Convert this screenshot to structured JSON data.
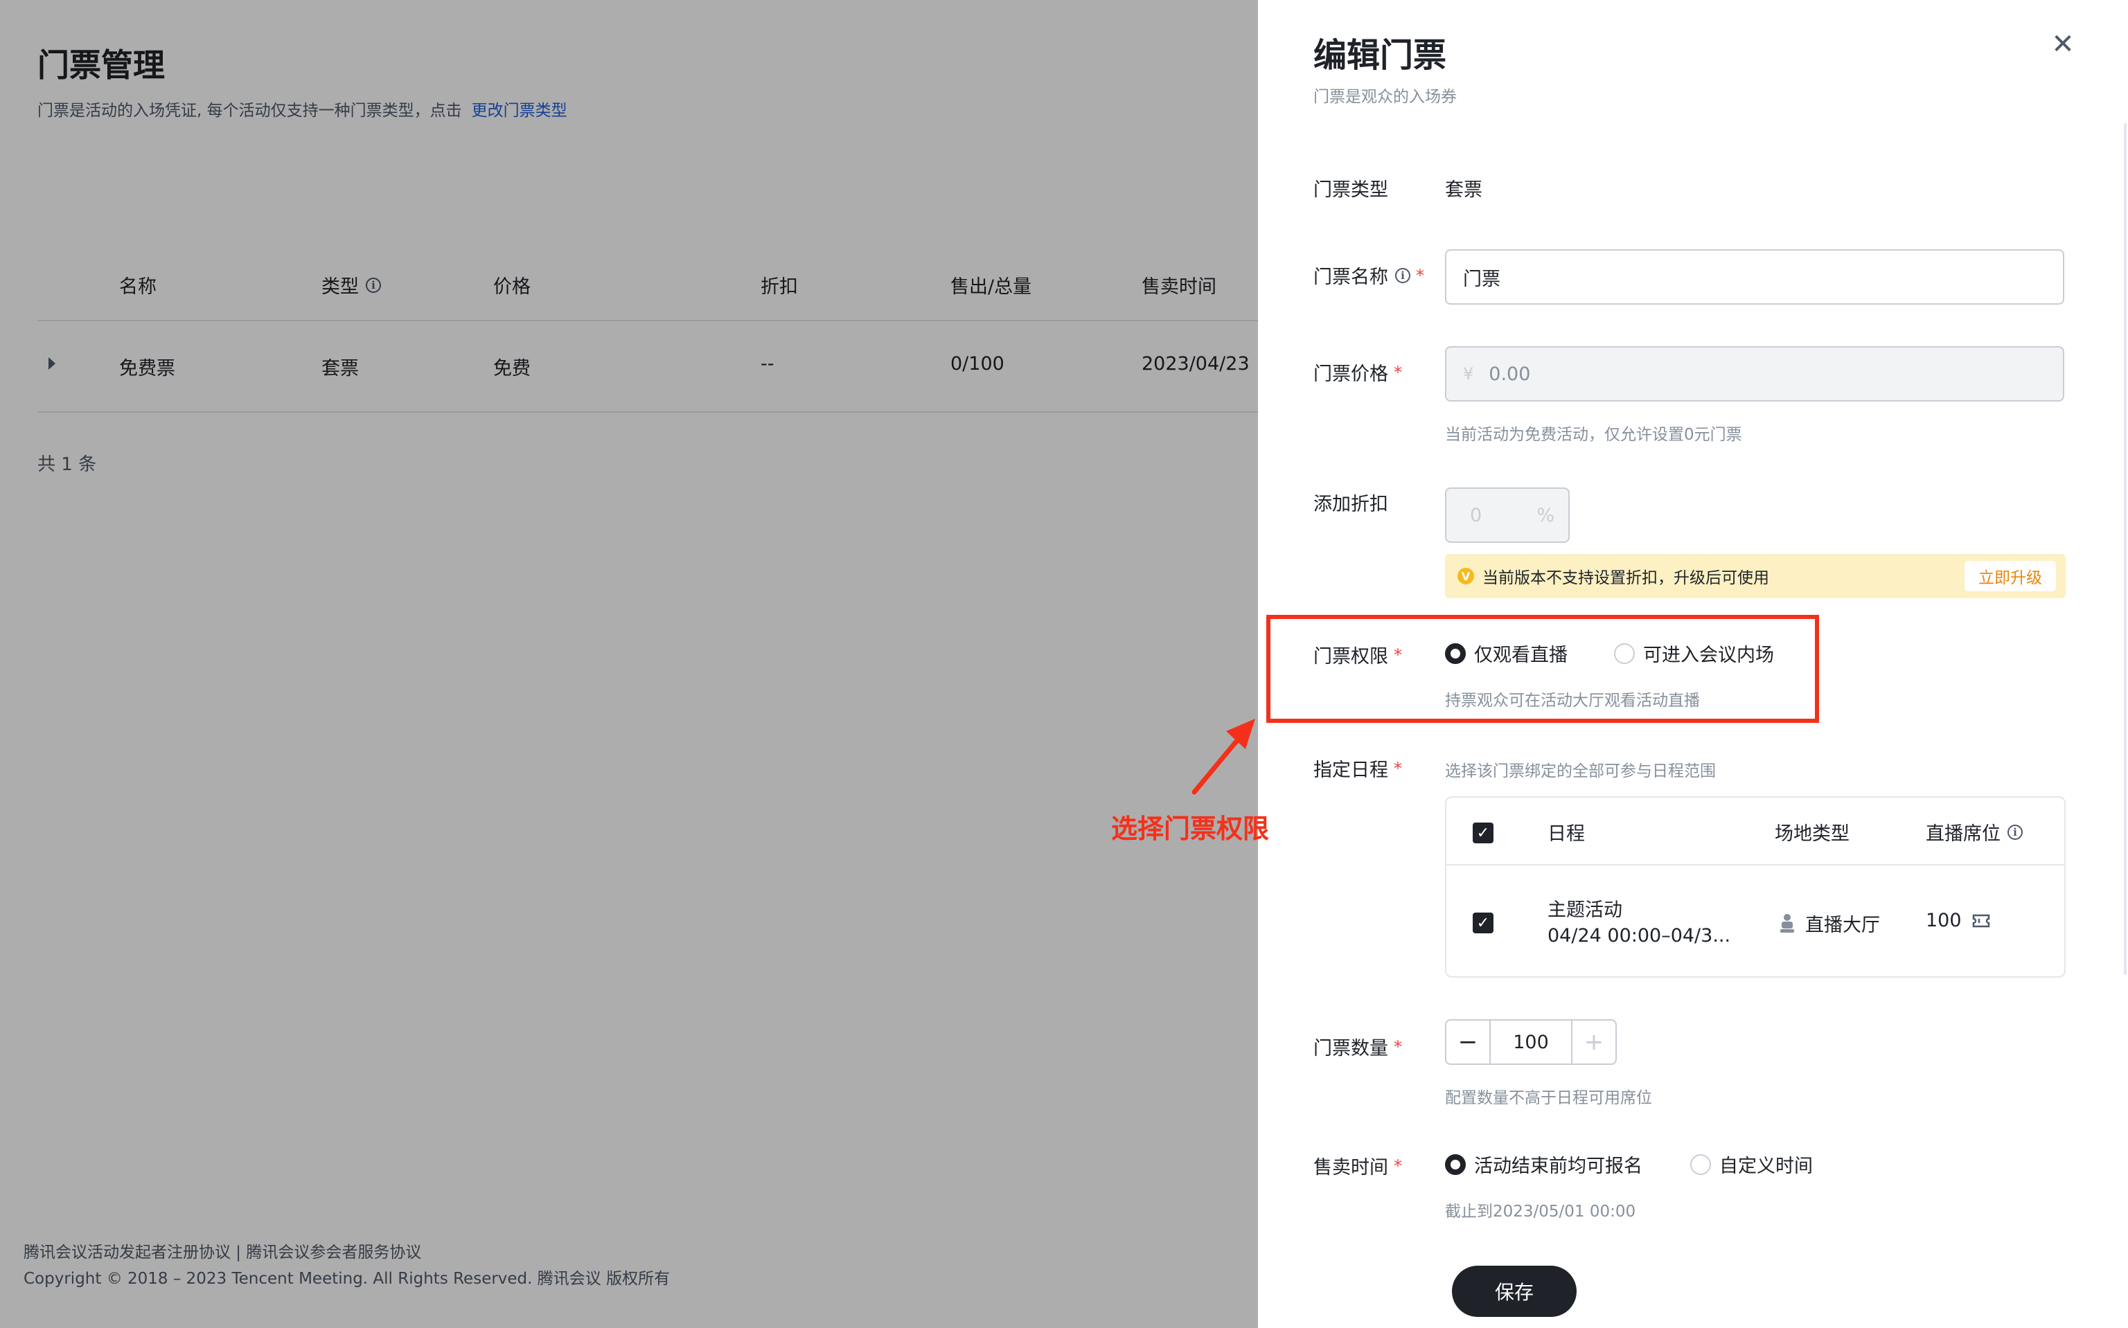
{
  "page": {
    "title": "门票管理",
    "description": "门票是活动的入场凭证, 每个活动仅支持一种门票类型，点击",
    "change_type_link": "更改门票类型",
    "table": {
      "headers": [
        "名称",
        "类型",
        "价格",
        "折扣",
        "售出/总量",
        "售卖时间"
      ],
      "rows": [
        {
          "name": "免费票",
          "type": "套票",
          "price": "免费",
          "discount": "--",
          "sold": "0/100",
          "sale_time": "2023/04/23"
        }
      ]
    },
    "total": "共 1 条",
    "footer": {
      "agreements": "腾讯会议活动发起者注册协议 | 腾讯会议参会者服务协议",
      "copyright": "Copyright © 2018 – 2023 Tencent Meeting. All Rights Reserved. 腾讯会议 版权所有"
    }
  },
  "annotation": {
    "text": "选择门票权限",
    "color": "#f5301a"
  },
  "drawer": {
    "title": "编辑门票",
    "subtitle": "门票是观众的入场券",
    "ticket_type": {
      "label": "门票类型",
      "value": "套票"
    },
    "ticket_name": {
      "label": "门票名称",
      "value": "门票"
    },
    "ticket_price": {
      "label": "门票价格",
      "currency": "¥",
      "value": "0.00",
      "hint": "当前活动为免费活动，仅允许设置0元门票"
    },
    "discount": {
      "label": "添加折扣",
      "value": "0",
      "unit": "%",
      "notice": "当前版本不支持设置折扣，升级后可使用",
      "upgrade_label": "立即升级"
    },
    "permission": {
      "label": "门票权限",
      "options": [
        {
          "label": "仅观看直播",
          "selected": true
        },
        {
          "label": "可进入会议内场",
          "selected": false
        }
      ],
      "hint": "持票观众可在活动大厅观看活动直播"
    },
    "schedule": {
      "label": "指定日程",
      "hint": "选择该门票绑定的全部可参与日程范围",
      "headers": [
        "日程",
        "场地类型",
        "直播席位"
      ],
      "rows": [
        {
          "name": "主题活动",
          "time": "04/24 00:00–04/3...",
          "venue": "直播大厅",
          "seats": "100",
          "checked": true
        }
      ]
    },
    "quantity": {
      "label": "门票数量",
      "value": "100",
      "hint": "配置数量不高于日程可用席位"
    },
    "sale_time": {
      "label": "售卖时间",
      "options": [
        {
          "label": "活动结束前均可报名",
          "selected": true
        },
        {
          "label": "自定义时间",
          "selected": false
        }
      ],
      "hint": "截止到2023/05/01 00:00"
    },
    "save_label": "保存"
  },
  "colors": {
    "primary": "#1f2329",
    "link": "#1f5fd8",
    "required": "#f53f3f",
    "warning_bg": "#fdf0c2",
    "upgrade_text": "#e8860b"
  }
}
